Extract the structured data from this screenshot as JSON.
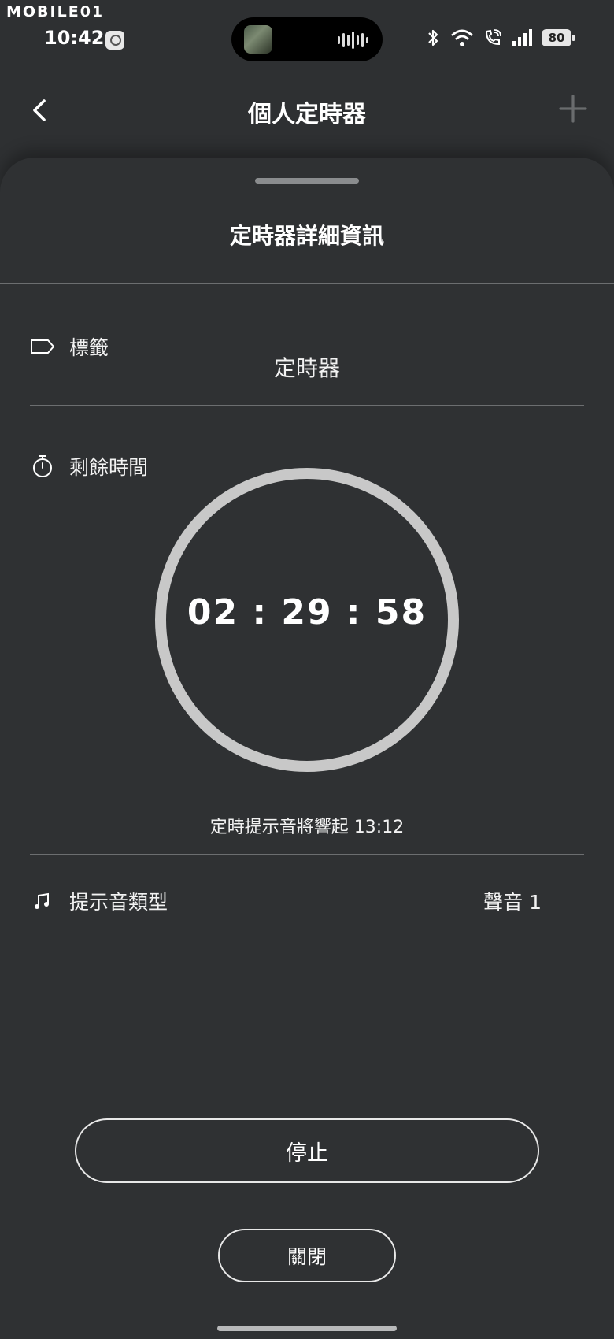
{
  "status_bar": {
    "watermark": "MOBILE01",
    "time": "10:42",
    "battery": "80"
  },
  "nav": {
    "title": "個人定時器",
    "back_icon": "chevron-left-icon",
    "add_icon": "plus-icon"
  },
  "sheet": {
    "title": "定時器詳細資訊",
    "label_section": {
      "icon": "tag-icon",
      "label": "標籤",
      "value": "定時器"
    },
    "remaining_section": {
      "icon": "stopwatch-icon",
      "label": "剩餘時間",
      "time": "02 : 29 : 58",
      "progress_fraction": 1.0,
      "alarm_note": "定時提示音將響起 13:12"
    },
    "sound_section": {
      "icon": "music-note-icon",
      "label": "提示音類型",
      "value": "聲音 1"
    },
    "buttons": {
      "stop": "停止",
      "close": "關閉"
    }
  },
  "colors": {
    "background": "#2e3032",
    "ring": "#c8c8c8",
    "text": "#ffffff",
    "divider": "#6c6e70"
  }
}
